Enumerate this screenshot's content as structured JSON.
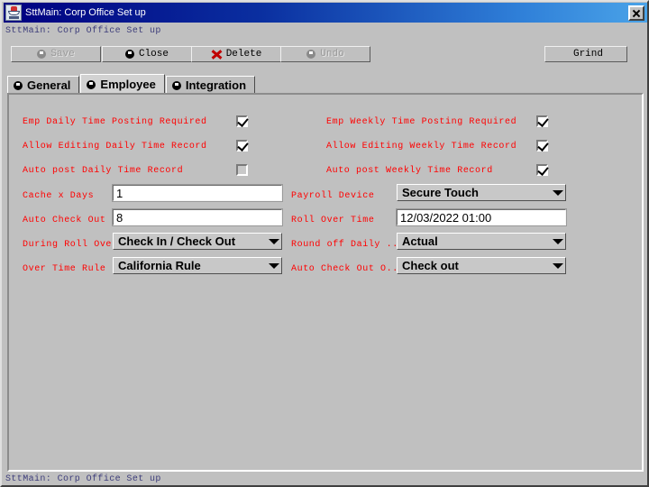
{
  "window": {
    "title": "SttMain: Corp Office Set up",
    "icon": "app-icon",
    "close_label": "x"
  },
  "subcaption": "SttMain: Corp Office Set up",
  "statusbar": "SttMain: Corp Office Set up",
  "toolbar": {
    "buttons": [
      {
        "label": "Save",
        "icon": "save-disc-icon",
        "disabled": true
      },
      {
        "label": "Close",
        "icon": "close-disc-icon",
        "disabled": false
      },
      {
        "label": "Delete",
        "icon": "delete-x-icon",
        "disabled": false
      },
      {
        "label": "Undo",
        "icon": "undo-disc-icon",
        "disabled": true
      }
    ],
    "grind_label": "Grind"
  },
  "tabs": [
    {
      "label": "General",
      "active": false,
      "icon": "gear-icon"
    },
    {
      "label": "Employee",
      "active": true,
      "icon": "gear-icon"
    },
    {
      "label": "Integration",
      "active": false,
      "icon": "gear-icon"
    }
  ],
  "form": {
    "checkboxes_left": [
      {
        "label": "Emp Daily Time Posting Required",
        "checked": true,
        "enabled": true
      },
      {
        "label": "Allow Editing Daily Time Record",
        "checked": true,
        "enabled": true
      },
      {
        "label": "Auto post Daily Time Record",
        "checked": false,
        "enabled": false
      }
    ],
    "checkboxes_right": [
      {
        "label": "Emp Weekly Time Posting Required",
        "checked": true,
        "enabled": true
      },
      {
        "label": "Allow Editing Weekly Time Record",
        "checked": true,
        "enabled": true
      },
      {
        "label": "Auto post Weekly Time Record",
        "checked": true,
        "enabled": true
      }
    ],
    "fields_left": [
      {
        "label": "Cache x Days",
        "type": "text",
        "value": "1"
      },
      {
        "label": "Auto Check Out x...",
        "type": "text",
        "value": "8"
      },
      {
        "label": "During Roll Over",
        "type": "combo",
        "value": "Check In / Check Out"
      },
      {
        "label": "Over Time Rule",
        "type": "combo",
        "value": "California Rule"
      }
    ],
    "fields_right": [
      {
        "label": "Payroll Device",
        "type": "combo",
        "value": "Secure Touch"
      },
      {
        "label": "Roll Over Time",
        "type": "text",
        "value": "12/03/2022 01:00"
      },
      {
        "label": "Round off Daily ...",
        "type": "combo",
        "value": "Actual"
      },
      {
        "label": "Auto Check Out O...",
        "type": "combo",
        "value": "Check out"
      }
    ]
  },
  "colors": {
    "label_red": "#ff0000",
    "face": "#c0c0c0",
    "title_blue": "#000080",
    "caption_text": "#3d3d7a"
  }
}
